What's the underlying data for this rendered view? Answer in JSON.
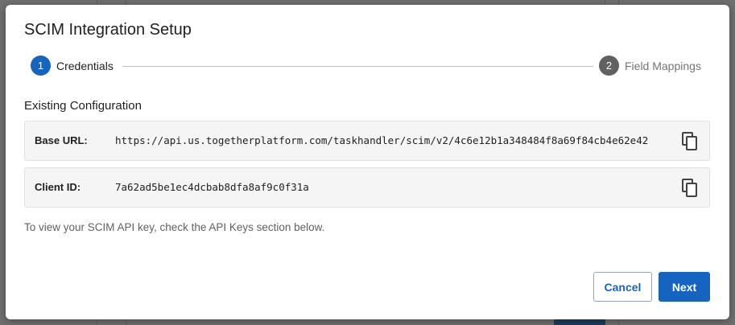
{
  "dialog": {
    "title": "SCIM Integration Setup"
  },
  "stepper": {
    "steps": [
      {
        "number": "1",
        "label": "Credentials",
        "state": "active"
      },
      {
        "number": "2",
        "label": "Field Mappings",
        "state": "inactive"
      }
    ]
  },
  "section": {
    "title": "Existing Configuration"
  },
  "fields": {
    "base_url": {
      "label": "Base URL:",
      "value": "https://api.us.togetherplatform.com/taskhandler/scim/v2/4c6e12b1a348484f8a69f84cb4e62e42",
      "copy_icon": "copy-icon"
    },
    "client_id": {
      "label": "Client ID:",
      "value": "7a62ad5be1ec4dcbab8dfa8af9c0f31a",
      "copy_icon": "copy-icon"
    }
  },
  "help_text": "To view your SCIM API key, check the API Keys section below.",
  "actions": {
    "cancel_label": "Cancel",
    "next_label": "Next"
  },
  "colors": {
    "primary": "#1565c0",
    "step_inactive": "#616161",
    "field_bg": "#f5f5f5"
  }
}
